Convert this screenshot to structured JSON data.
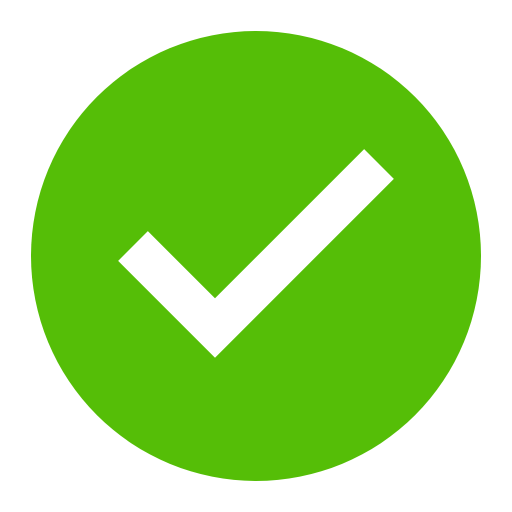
{
  "icon": {
    "name": "checkmark-circle-icon",
    "circle_color": "#55BE07",
    "check_color": "#FFFFFF",
    "background_color": "#FFFFFF"
  }
}
